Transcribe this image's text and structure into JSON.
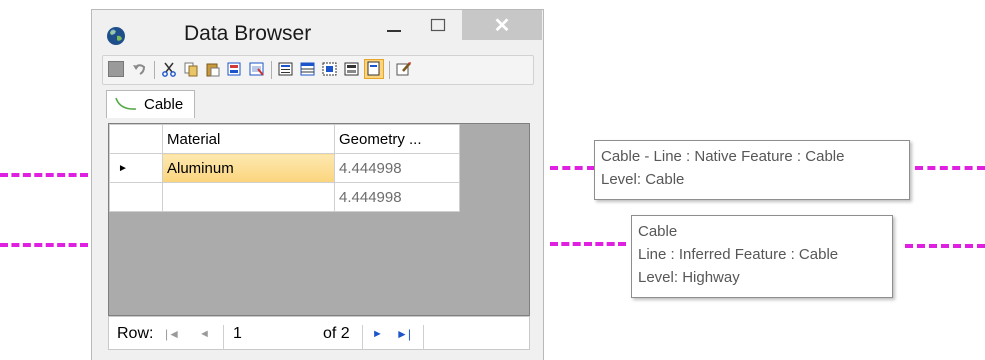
{
  "window": {
    "title": "Data Browser",
    "min_glyph": "—",
    "max_glyph": "☐",
    "close_glyph": "✕"
  },
  "toolbar": {
    "icons": [
      "save-icon",
      "undo-icon",
      "cut-icon",
      "copy-icon",
      "paste-icon",
      "select-icon",
      "zoom-icon",
      "view-properties-icon",
      "view-table-icon",
      "view-list-icon",
      "view-form-icon",
      "view-single-icon",
      "options-icon"
    ]
  },
  "tab": {
    "label": "Cable"
  },
  "grid": {
    "columns": [
      "Material",
      "Geometry ..."
    ],
    "rows": [
      {
        "current": "►",
        "material": "Aluminum",
        "geometry": "4.444998"
      },
      {
        "current": "",
        "material": "",
        "geometry": "4.444998"
      }
    ]
  },
  "nav": {
    "row_label": "Row:",
    "first_glyph": "|◄",
    "prev_glyph": "◄",
    "current_row": "1",
    "of_label": "of 2",
    "next_glyph": "►",
    "last_glyph": "►|"
  },
  "tooltips": [
    {
      "lines": [
        "Cable - Line : Native Feature : Cable",
        "Level: Cable"
      ]
    },
    {
      "lines": [
        "Cable",
        "Line : Inferred Feature : Cable",
        "Level: Highway"
      ]
    }
  ],
  "colors": {
    "connector_dash": "#e020e0",
    "selected_cell": "#fbd57d",
    "grid_background": "#ababab"
  }
}
